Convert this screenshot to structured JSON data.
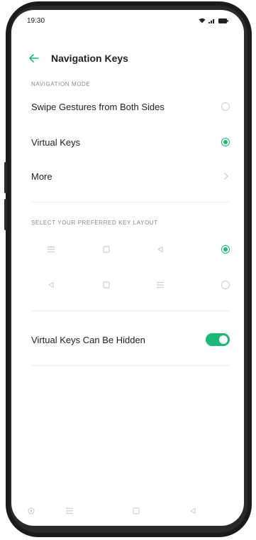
{
  "status_bar": {
    "time": "19:30"
  },
  "header": {
    "title": "Navigation Keys"
  },
  "sections": {
    "navigation_mode": "NAVIGATION MODE",
    "key_layout": "SELECT YOUR PREFERRED KEY LAYOUT"
  },
  "options": {
    "swipe_gestures": "Swipe Gestures from Both Sides",
    "virtual_keys": "Virtual Keys",
    "more": "More",
    "virtual_keys_hidden": "Virtual Keys Can Be Hidden"
  },
  "state": {
    "selected_mode": "Virtual Keys",
    "selected_layout": 1,
    "virtual_keys_hidden_enabled": true
  },
  "colors": {
    "accent": "#1bb878"
  },
  "icons": {
    "layout_1": [
      "menu-icon",
      "square-icon",
      "back-triangle-icon"
    ],
    "layout_2": [
      "back-triangle-icon",
      "square-icon",
      "menu-icon"
    ],
    "bottom_nav": [
      "settings-icon",
      "menu-icon",
      "square-icon",
      "back-triangle-icon"
    ]
  }
}
